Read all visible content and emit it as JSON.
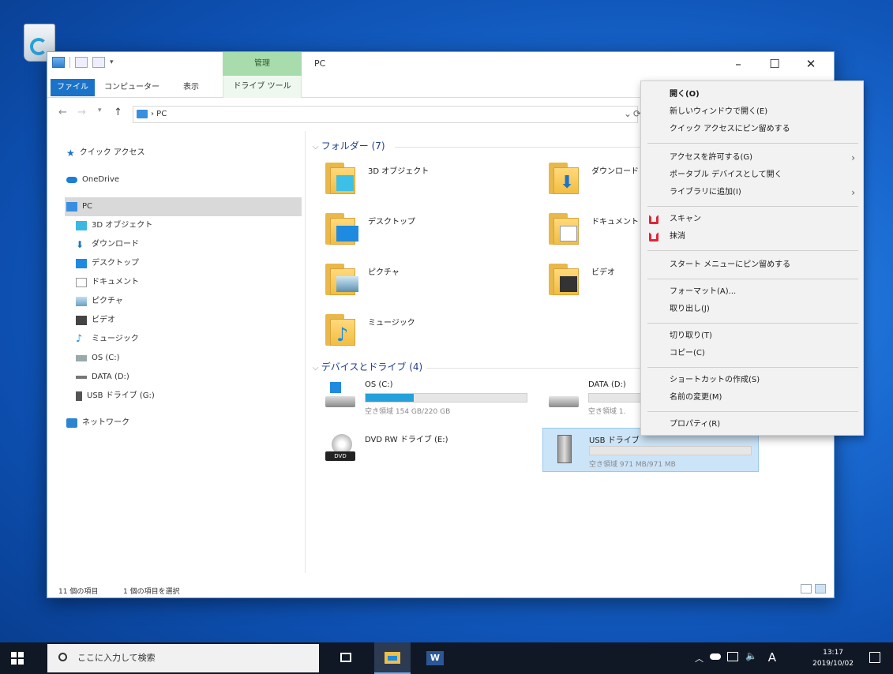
{
  "window": {
    "title": "PC",
    "manage_tab": "管理",
    "drive_tools_tab": "ドライブ ツール",
    "tabs": [
      "ファイル",
      "コンピューター",
      "表示"
    ],
    "min": "–",
    "max": "☐",
    "close": "✕"
  },
  "address": {
    "back": "←",
    "fwd": "→",
    "up": "↑",
    "path": "› PC",
    "refresh": "⟳"
  },
  "nav": {
    "quick": "クイック アクセス",
    "onedrive": "OneDrive",
    "pc": "PC",
    "items": [
      "3D オブジェクト",
      "ダウンロード",
      "デスクトップ",
      "ドキュメント",
      "ピクチャ",
      "ビデオ",
      "ミュージック",
      "OS (C:)",
      "DATA (D:)",
      "USB ドライブ (G:)"
    ],
    "network": "ネットワーク"
  },
  "folders_group": "フォルダー (7)",
  "folders": [
    "3D オブジェクト",
    "ダウンロード",
    "デスクトップ",
    "ドキュメント",
    "ピクチャ",
    "ビデオ",
    "ミュージック"
  ],
  "drives_group": "デバイスとドライブ (4)",
  "drives": [
    {
      "name": "OS (C:)",
      "info": "空き領域 154 GB/220 GB",
      "used": 0.3
    },
    {
      "name": "DATA (D:)",
      "info": "空き領域 1.",
      "used": 0.0
    },
    {
      "name": "DVD RW ドライブ (E:)",
      "info": ""
    },
    {
      "name": "USB ドライブ",
      "info": "空き領域 971 MB/971 MB",
      "used": 0.0
    }
  ],
  "status": {
    "count": "11 個の項目",
    "selected": "1 個の項目を選択"
  },
  "context_menu": [
    "開く(O)",
    "新しいウィンドウで開く(E)",
    "クイック アクセスにピン留めする",
    "アクセスを許可する(G)",
    "ポータブル デバイスとして開く",
    "ライブラリに追加(I)",
    "スキャン",
    "抹消",
    "スタート メニューにピン留めする",
    "フォーマット(A)...",
    "取り出し(J)",
    "切り取り(T)",
    "コピー(C)",
    "ショートカットの作成(S)",
    "名前の変更(M)",
    "プロパティ(R)"
  ],
  "taskbar": {
    "search": "ここに入力して検索",
    "time": "13:17",
    "date": "2019/10/02",
    "ime": "A"
  },
  "colors": {
    "accent": "#1a73c9",
    "selection": "#cce4f7",
    "manage": "#a8dcac"
  }
}
